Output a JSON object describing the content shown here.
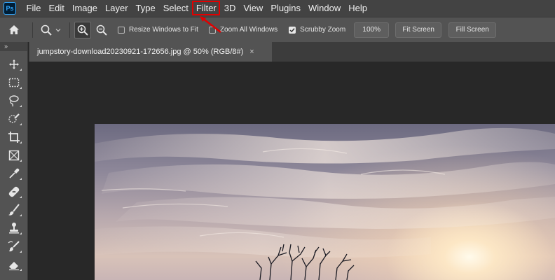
{
  "app": {
    "logo_text": "Ps"
  },
  "menu": {
    "items": [
      "File",
      "Edit",
      "Image",
      "Layer",
      "Type",
      "Select",
      "Filter",
      "3D",
      "View",
      "Plugins",
      "Window",
      "Help"
    ],
    "highlighted": "Filter"
  },
  "options": {
    "resize_windows_label": "Resize Windows to Fit",
    "resize_windows_checked": false,
    "zoom_all_label": "Zoom All Windows",
    "zoom_all_checked": false,
    "scrubby_zoom_label": "Scrubby Zoom",
    "scrubby_zoom_checked": true,
    "zoom_value": "100%",
    "fit_screen_label": "Fit Screen",
    "fill_screen_label": "Fill Screen"
  },
  "toolbar_collapse": "»",
  "document": {
    "tab_title": "jumpstory-download20230921-172656.jpg @ 50% (RGB/8#)",
    "close_glyph": "×"
  },
  "tools": [
    "move-tool-icon",
    "marquee-tool-icon",
    "lasso-tool-icon",
    "quick-selection-tool-icon",
    "crop-tool-icon",
    "frame-tool-icon",
    "eyedropper-tool-icon",
    "healing-brush-tool-icon",
    "brush-tool-icon",
    "clone-stamp-tool-icon",
    "history-brush-tool-icon",
    "eraser-tool-icon"
  ],
  "colors": {
    "annotation": "#e10000",
    "menubar": "#434343",
    "panel": "#535353",
    "canvas": "#282828"
  }
}
